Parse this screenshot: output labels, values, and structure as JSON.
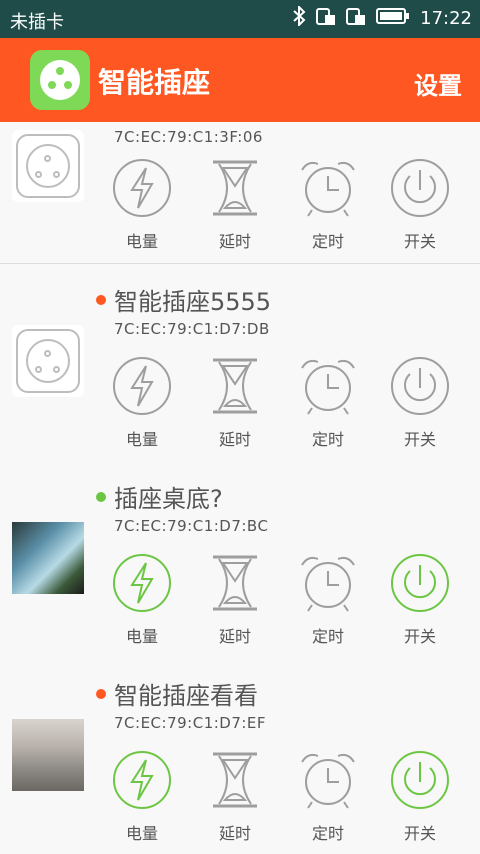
{
  "status_bar": {
    "carrier": "未插卡",
    "time": "17:22",
    "icons": [
      "bluetooth-icon",
      "sim-slot-1-icon",
      "sim-slot-2-icon",
      "battery-icon"
    ]
  },
  "app_bar": {
    "title": "智能插座",
    "settings_label": "设置",
    "logo_icon": "socket-logo-icon",
    "colors": {
      "bar": "#ff5722",
      "logo_bg": "#7ed957"
    }
  },
  "actions": {
    "power_label": "电量",
    "delay_label": "延时",
    "timer_label": "定时",
    "switch_label": "开关"
  },
  "devices": [
    {
      "name": "",
      "mac": "7C:EC:79:C1:3F:06",
      "status_color": "",
      "active": false,
      "thumbnail": "socket-icon"
    },
    {
      "name": "智能插座5555",
      "mac": "7C:EC:79:C1:D7:DB",
      "status_color": "#ff5722",
      "active": false,
      "thumbnail": "socket-icon"
    },
    {
      "name": "插座桌底?",
      "mac": "7C:EC:79:C1:D7:BC",
      "status_color": "#6cc644",
      "active": true,
      "thumbnail": "photo"
    },
    {
      "name": "智能插座看看",
      "mac": "7C:EC:79:C1:D7:EF",
      "status_color": "#ff5722",
      "active": true,
      "thumbnail": "photo"
    }
  ]
}
